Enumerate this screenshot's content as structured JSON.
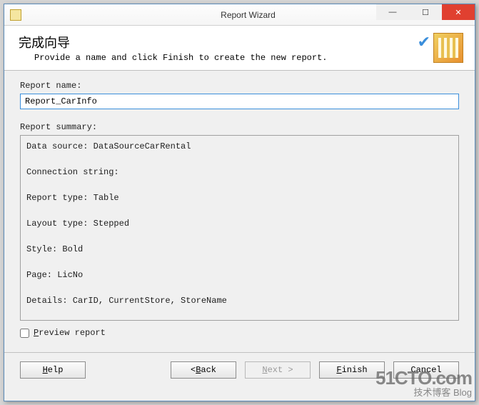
{
  "titlebar": {
    "title": "Report Wizard"
  },
  "header": {
    "heading": "完成向导",
    "subtitle": "Provide a name and click Finish to create the new report."
  },
  "form": {
    "name_label": "Report name:",
    "name_value": "Report_CarInfo",
    "summary_label": "Report summary:",
    "summary_text": "Data source: DataSourceCarRental\n\nConnection string:\n\nReport type: Table\n\nLayout type: Stepped\n\nStyle: Bold\n\nPage: LicNo\n\nDetails: CarID, CurrentStore, StoreName\n\nQuery:  SELECT   CarID, LicNo, CurrentStore, StoreName\nFROM     View_CarStore",
    "preview_label_pre": "P",
    "preview_label_post": "review report"
  },
  "buttons": {
    "help_u": "H",
    "help_post": "elp",
    "back_pre": "< ",
    "back_u": "B",
    "back_post": "ack",
    "next_u": "N",
    "next_post": "ext >",
    "finish_u": "F",
    "finish_post": "inish",
    "cancel_label": "Cancel"
  },
  "watermark": {
    "big": "51CTO.com",
    "small": "技术博客   Blog"
  }
}
